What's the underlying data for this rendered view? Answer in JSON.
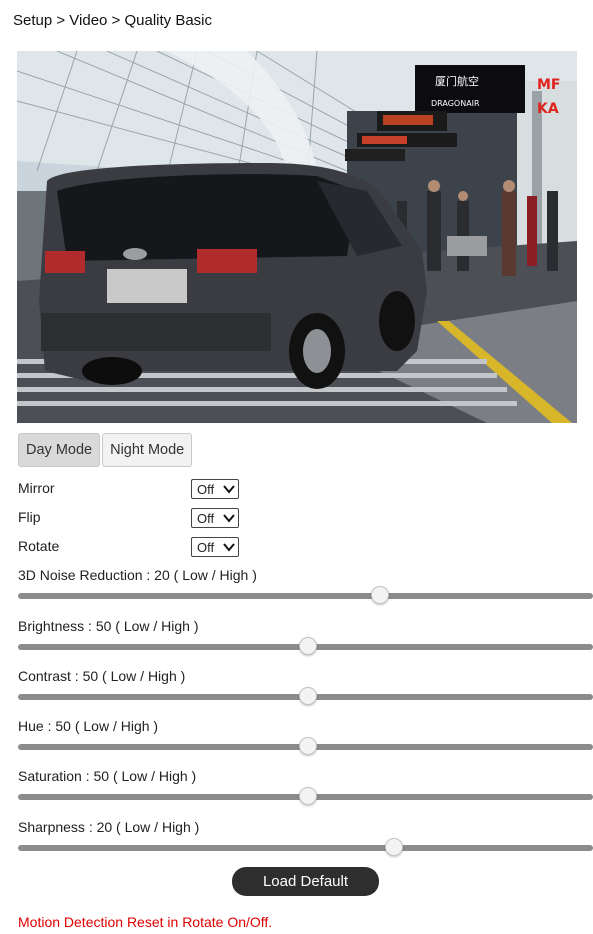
{
  "breadcrumb": "Setup > Video > Quality Basic",
  "modes": {
    "day": "Day Mode",
    "night": "Night Mode",
    "active": "day"
  },
  "toggles": [
    {
      "label": "Mirror",
      "value": "Off"
    },
    {
      "label": "Flip",
      "value": "Off"
    },
    {
      "label": "Rotate",
      "value": "Off"
    }
  ],
  "sliders": [
    {
      "name": "noise",
      "label": "3D Noise Reduction : 20 ( Low / High )",
      "value": 20,
      "level": 0.63
    },
    {
      "name": "brightness",
      "label": "Brightness : 50 ( Low / High )",
      "value": 50,
      "level": 0.505
    },
    {
      "name": "contrast",
      "label": "Contrast : 50 ( Low / High )",
      "value": 50,
      "level": 0.505
    },
    {
      "name": "hue",
      "label": "Hue : 50 ( Low / High )",
      "value": 50,
      "level": 0.505
    },
    {
      "name": "saturation",
      "label": "Saturation : 50 ( Low / High )",
      "value": 50,
      "level": 0.505
    },
    {
      "name": "sharpness",
      "label": "Sharpness : 20 ( Low / High )",
      "value": 20,
      "level": 0.654
    }
  ],
  "load_default": "Load Default",
  "notice": {
    "text": "Motion Detection Reset in Rotate On/Off.",
    "color": "#e00000"
  },
  "video": {
    "sign_line1": "厦门航空",
    "sign_line2": "DRAGONAIR",
    "sign_right": "MF",
    "sign_right2": "KA"
  },
  "colors": {
    "slider_track": "#8c8c8c",
    "button_dark": "#2e2e2e"
  }
}
